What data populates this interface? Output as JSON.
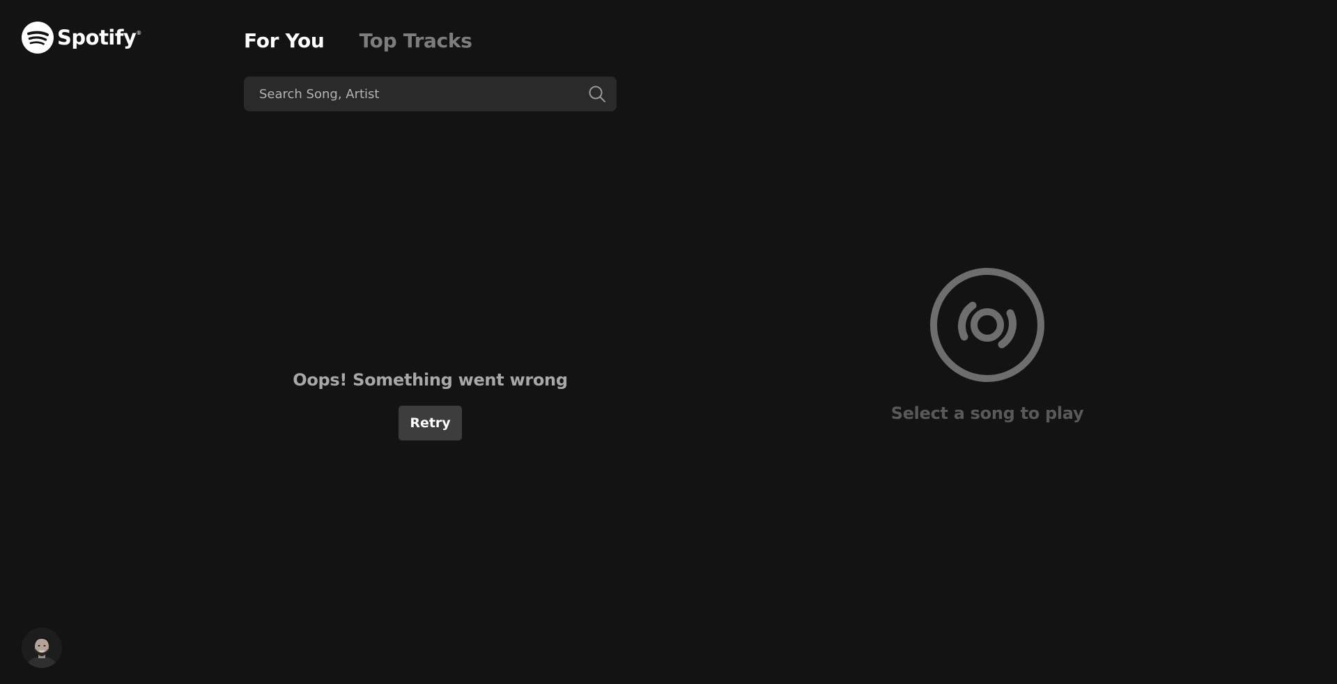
{
  "app": {
    "brand_name": "Spotify",
    "brand_mark": "®"
  },
  "tabs": [
    {
      "label": "For You",
      "active": true
    },
    {
      "label": "Top Tracks",
      "active": false
    }
  ],
  "search": {
    "placeholder": "Search Song, Artist",
    "value": "",
    "icon": "search-icon"
  },
  "error": {
    "message": "Oops! Something went wrong",
    "retry_label": "Retry"
  },
  "player": {
    "empty_message": "Select a song to play",
    "icon": "disc-icon"
  },
  "user": {
    "avatar_icon": "user-avatar"
  },
  "colors": {
    "background": "#131313",
    "search_bg": "#2a2a2a",
    "button_bg": "#3d3d3d",
    "inactive_tab": "#7d7d7d",
    "muted_text": "#595959"
  }
}
